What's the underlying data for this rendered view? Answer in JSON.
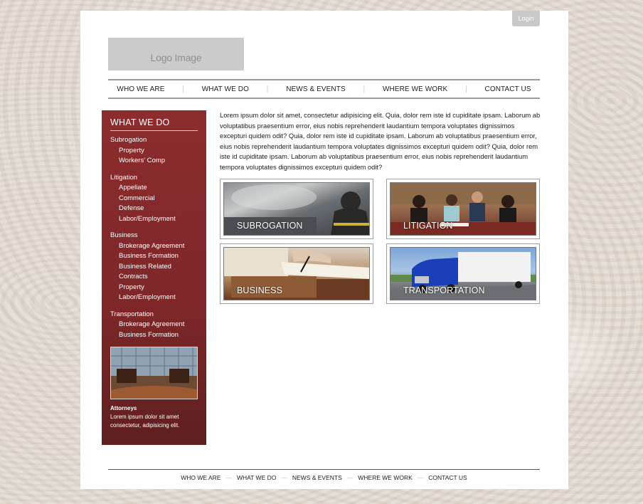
{
  "header": {
    "login_label": "Login",
    "logo_text": "Logo Image"
  },
  "nav": {
    "items": [
      "WHO WE ARE",
      "WHAT WE DO",
      "NEWS & EVENTS",
      "WHERE WE WORK",
      "CONTACT US"
    ]
  },
  "sidebar": {
    "title": "WHAT WE DO",
    "groups": [
      {
        "title": "Subrogation",
        "items": [
          "Property",
          "Workers' Comp"
        ]
      },
      {
        "title": "Litigation",
        "items": [
          "Appeliate",
          "Commercial",
          "Defense",
          "Labor/Employment"
        ]
      },
      {
        "title": "Business",
        "items": [
          "Brokerage Agreement",
          "Business Formation",
          "Business Related",
          "Contracts",
          "Property",
          "Labor/Employment"
        ]
      },
      {
        "title": "Transportation",
        "items": [
          "Brokerage Agreement",
          "Business Formation"
        ]
      }
    ],
    "attorneys_title": "Attorneys",
    "attorneys_text": "Lorem ipsum dolor sit amet consectetur, adipisicing elit."
  },
  "main": {
    "intro": "Lorem ipsum dolor sit amet, consectetur adipisicing elit. Quia, dolor rem iste id cupiditate ipsam. Laborum ab voluptatibus praesentium error, eius nobis reprehenderit laudantium tempora voluptates dignissimos excepturi quidem odit? Quia, dolor rem iste id cupiditate ipsam. Laborum ab voluptatibus praesentium error, eius nobis reprehenderit laudantium tempora voluptates dignissimos excepturi quidem odit? Quia, dolor rem iste id cupiditate ipsam. Laborum ab voluptatibus praesentium error, eius nobis reprehenderit laudantium tempora voluptates dignissimos excepturi quidem odit?",
    "tiles": [
      "SUBROGATION",
      "LITIGATION",
      "BUSINESS",
      "TRANSPORTATION"
    ]
  },
  "footer": {
    "items": [
      "WHO WE ARE",
      "WHAT WE DO",
      "NEWS & EVENTS",
      "WHERE WE WORK",
      "CONTACT US"
    ],
    "separator": "—"
  },
  "colors": {
    "sidebar": "#8c2c2e",
    "login": "#c8c8c8"
  }
}
